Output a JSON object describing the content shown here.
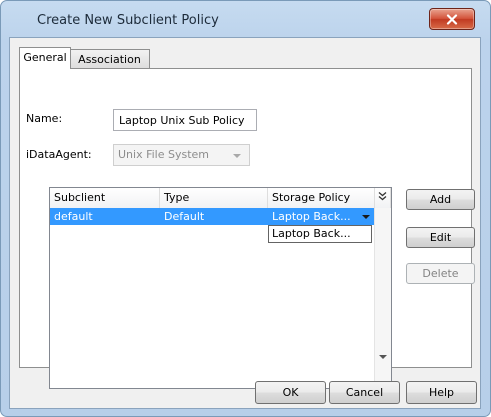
{
  "window": {
    "title": "Create New Subclient Policy"
  },
  "tabs": [
    {
      "label": "General",
      "active": true
    },
    {
      "label": "Association",
      "active": false
    }
  ],
  "general": {
    "name_label": "Name:",
    "name_value": "Laptop Unix Sub Policy",
    "agent_label": "iDataAgent:",
    "agent_value": "Unix File System"
  },
  "grid": {
    "columns": [
      "Subclient",
      "Type",
      "Storage Policy"
    ],
    "column_chooser_icon": "double-chevron-down-icon",
    "rows": [
      {
        "subclient": "default",
        "type": "Default",
        "storage_policy": "Laptop Back...",
        "selected": true
      }
    ],
    "dropdown_options": [
      "Laptop Back..."
    ]
  },
  "side_buttons": {
    "add": "Add",
    "edit": "Edit",
    "delete": "Delete"
  },
  "bottom_buttons": {
    "ok": "OK",
    "cancel": "Cancel",
    "help": "Help"
  },
  "colors": {
    "selection": "#3399ff",
    "close_button": "#c7442b",
    "frame": "#bcd3ec"
  }
}
